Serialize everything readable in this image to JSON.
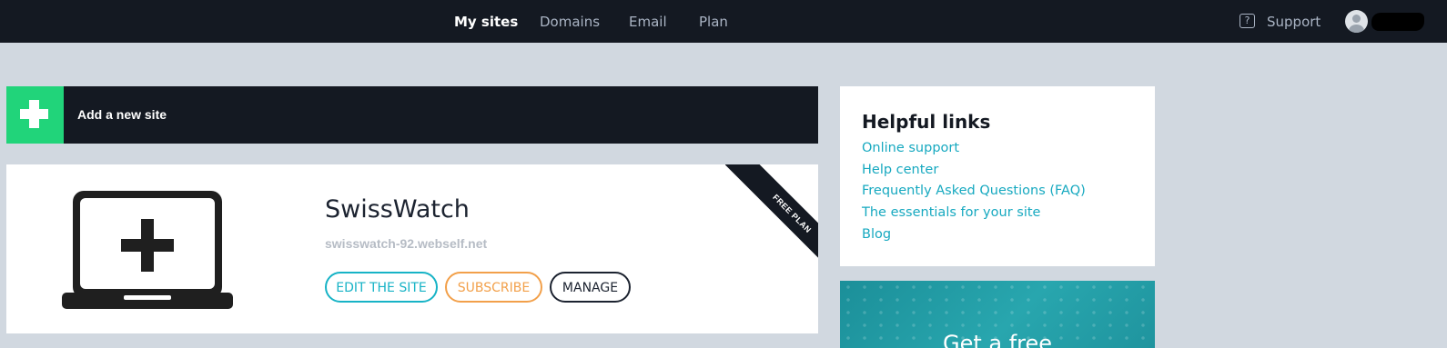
{
  "nav": {
    "links": [
      {
        "label": "My sites",
        "active": true
      },
      {
        "label": "Domains"
      },
      {
        "label": "Email"
      },
      {
        "label": "Plan"
      }
    ],
    "support_label": "Support"
  },
  "add_site": {
    "label": "Add a new site"
  },
  "site": {
    "name": "SwissWatch",
    "url": "swisswatch-92.webself.net",
    "ribbon": "FREE PLAN",
    "buttons": {
      "edit": "EDIT THE SITE",
      "subscribe": "SUBSCRIBE",
      "manage": "MANAGE"
    }
  },
  "helpful_links": {
    "title": "Helpful links",
    "links": [
      "Online support",
      "Help center",
      "Frequently Asked Questions (FAQ)",
      "The essentials for your site",
      "Blog"
    ]
  },
  "promo": {
    "text": "Get a free"
  },
  "colors": {
    "brand_green": "#21d47a",
    "link_teal": "#17a9c0",
    "subscribe_orange": "#f2a04a",
    "dark": "#141922"
  }
}
